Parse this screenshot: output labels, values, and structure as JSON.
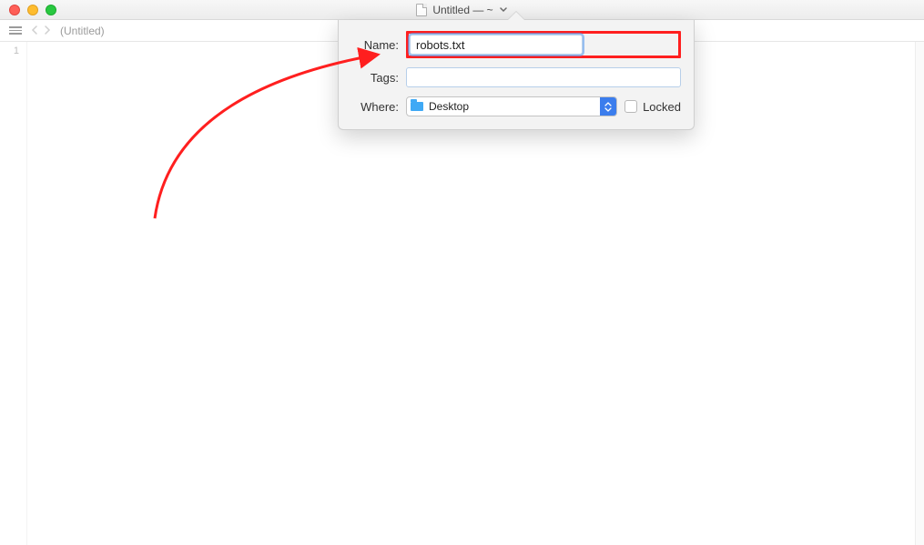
{
  "window": {
    "title": "Untitled — ~",
    "path_crumb": "(Untitled)"
  },
  "gutter": {
    "line_1": "1"
  },
  "sheet": {
    "name_label": "Name:",
    "name_value": "robots.txt",
    "tags_label": "Tags:",
    "tags_value": "",
    "where_label": "Where:",
    "where_value": "Desktop",
    "locked_label": "Locked"
  }
}
